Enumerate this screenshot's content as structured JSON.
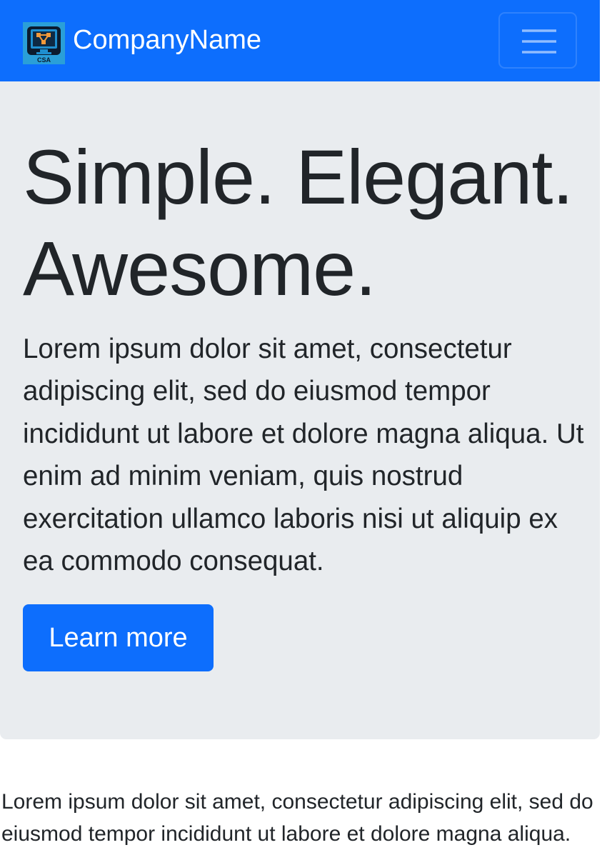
{
  "navbar": {
    "brand_name": "CompanyName",
    "logo_text": "CSA",
    "logo_icon": "monitor-network-logo",
    "menu_icon": "hamburger-menu-icon",
    "background_color": "#0d6efd"
  },
  "hero": {
    "title_line1": "Simple. Elegant.",
    "title_line2": "Awesome.",
    "lead": "Lorem ipsum dolor sit amet, consectetur adipiscing elit, sed do eiusmod tempor incididunt ut labore et dolore magna aliqua. Ut enim ad minim veniam, quis nostrud exercitation ullamco laboris nisi ut aliquip ex ea commodo consequat.",
    "button_label": "Learn more",
    "background_color": "#e9ecef",
    "button_color": "#0d6efd"
  },
  "content": {
    "paragraph": "Lorem ipsum dolor sit amet, consectetur adipiscing elit, sed do eiusmod tempor incididunt ut labore et dolore magna aliqua."
  }
}
